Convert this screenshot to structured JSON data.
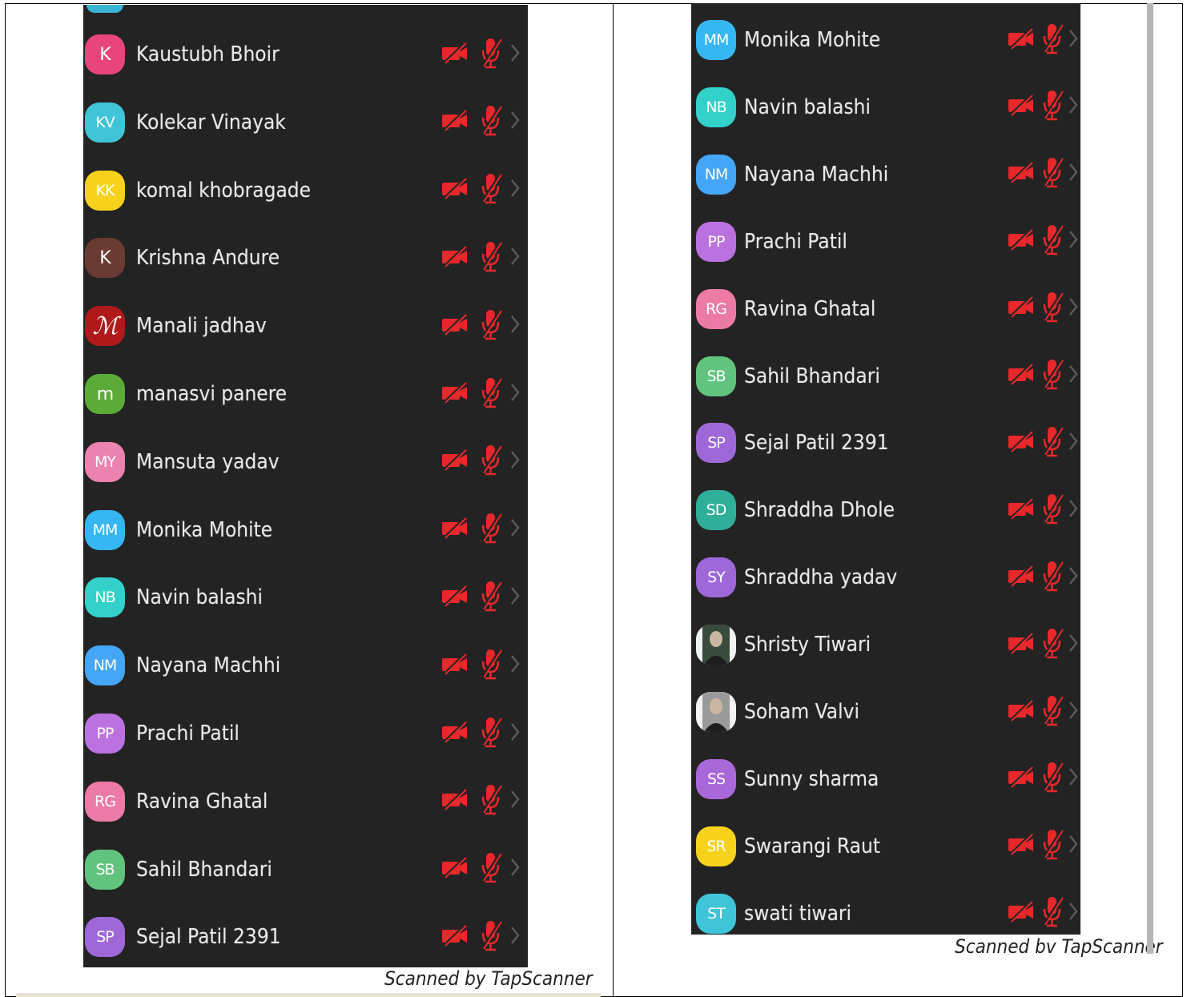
{
  "colors": {
    "panel_bg": "#232323",
    "icon_red": "#e8282b",
    "chevron": "#5a5a5a"
  },
  "left_list": {
    "participants": [
      {
        "initials": "K",
        "name": "Kaustubh Bhoir",
        "avatar_color": "#e8457c"
      },
      {
        "initials": "KV",
        "name": "Kolekar Vinayak",
        "avatar_color": "#40c4d8"
      },
      {
        "initials": "KK",
        "name": "komal khobragade",
        "avatar_color": "#f6d21c"
      },
      {
        "initials": "K",
        "name": "Krishna Andure",
        "avatar_color": "#6a3b32"
      },
      {
        "initials": "M",
        "name": "Manali jadhav",
        "avatar_color": "#b01919",
        "photo": "script-m-logo"
      },
      {
        "initials": "m",
        "name": "manasvi panere",
        "avatar_color": "#5cab39"
      },
      {
        "initials": "MY",
        "name": "Mansuta yadav",
        "avatar_color": "#ec82b0"
      },
      {
        "initials": "MM",
        "name": "Monika Mohite",
        "avatar_color": "#36b6f2"
      },
      {
        "initials": "NB",
        "name": "Navin balashi",
        "avatar_color": "#33d1c9"
      },
      {
        "initials": "NM",
        "name": "Nayana Machhi",
        "avatar_color": "#45a5f6"
      },
      {
        "initials": "PP",
        "name": "Prachi Patil",
        "avatar_color": "#bb72e0"
      },
      {
        "initials": "RG",
        "name": "Ravina Ghatal",
        "avatar_color": "#ec7aa6"
      },
      {
        "initials": "SB",
        "name": "Sahil Bhandari",
        "avatar_color": "#62c37f"
      },
      {
        "initials": "SP",
        "name": "Sejal Patil  2391",
        "avatar_color": "#9f68d9"
      }
    ],
    "footer": "Scanned by TapScanner"
  },
  "right_list": {
    "participants": [
      {
        "initials": "MM",
        "name": "Monika Mohite",
        "avatar_color": "#36b6f2"
      },
      {
        "initials": "NB",
        "name": "Navin balashi",
        "avatar_color": "#33d1c9"
      },
      {
        "initials": "NM",
        "name": "Nayana Machhi",
        "avatar_color": "#45a5f6"
      },
      {
        "initials": "PP",
        "name": "Prachi Patil",
        "avatar_color": "#bb72e0"
      },
      {
        "initials": "RG",
        "name": "Ravina Ghatal",
        "avatar_color": "#ec7aa6"
      },
      {
        "initials": "SB",
        "name": "Sahil Bhandari",
        "avatar_color": "#62c37f"
      },
      {
        "initials": "SP",
        "name": "Sejal Patil  2391",
        "avatar_color": "#9f68d9"
      },
      {
        "initials": "SD",
        "name": "Shraddha Dhole",
        "avatar_color": "#2fae99"
      },
      {
        "initials": "SY",
        "name": "Shraddha yadav",
        "avatar_color": "#9f68d9"
      },
      {
        "initials": "",
        "name": "Shristy Tiwari",
        "avatar_color": "#3a4a3c",
        "photo": "user-photo"
      },
      {
        "initials": "",
        "name": "Soham Valvi",
        "avatar_color": "#9a9a9a",
        "photo": "user-photo"
      },
      {
        "initials": "SS",
        "name": "Sunny sharma",
        "avatar_color": "#a968d9"
      },
      {
        "initials": "SR",
        "name": "Swarangi Raut",
        "avatar_color": "#f6d21c"
      },
      {
        "initials": "ST",
        "name": "swati tiwari",
        "avatar_color": "#40c4d8"
      }
    ],
    "footer": "Scanned bv TapScanner"
  }
}
